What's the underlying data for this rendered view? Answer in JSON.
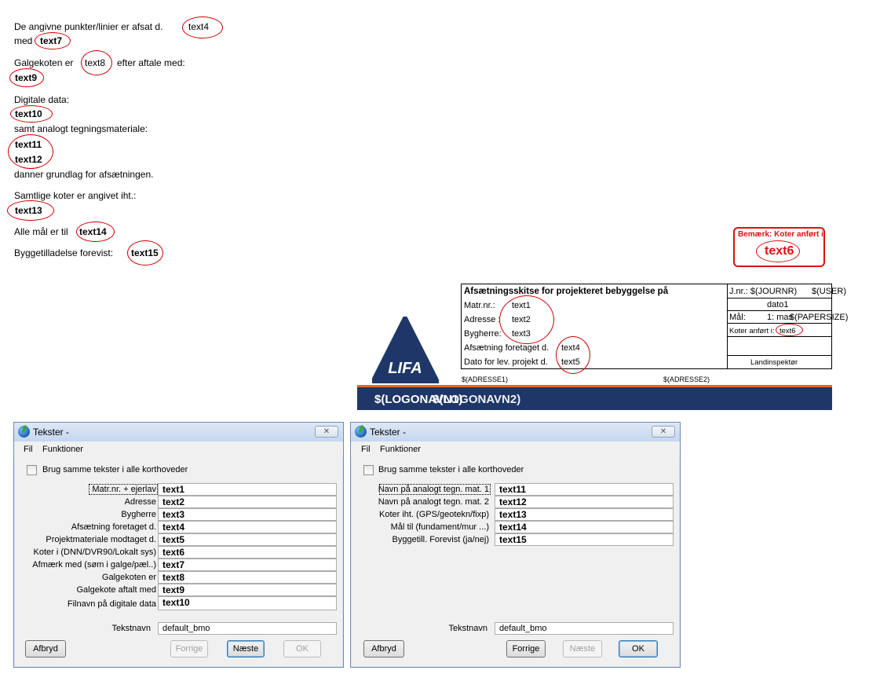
{
  "drawing": {
    "notes": {
      "line1": "De angivne punkter/linier er afsat d.",
      "line1_val": "text4",
      "med": "med",
      "med_val": "text7",
      "galge": "Galgekoten er",
      "galge_val": "text8",
      "galge_rest": "efter aftale med:",
      "text9": "text9",
      "digitale": "Digitale data:",
      "text10": "text10",
      "analogt": "samt analogt tegningsmateriale:",
      "text11": "text11",
      "text12": "text12",
      "danner": "danner grundlag for afsætningen.",
      "koter": "Samtlige koter er angivet iht.:",
      "text13": "text13",
      "maal": "Alle mål er til",
      "maal_val": "text14",
      "bygge": "Byggetilladelse forevist:",
      "bygge_val": "text15"
    },
    "remark": {
      "label": "Bemærk: Koter anført i",
      "value": "text6"
    },
    "title_block": {
      "heading": "Afsætningsskitse for projekteret bebyggelse på",
      "matr_label": "Matr.nr.:",
      "matr_val": "text1",
      "adresse_label": "Adresse :",
      "adresse_val": "text2",
      "bygherre_label": "Bygherre:",
      "bygherre_val": "text3",
      "afsat_label": "Afsætning foretaget d.",
      "afsat_val": "text4",
      "dato_label": "Dato for lev. projekt d.",
      "dato_val": "text5",
      "jnr": "J.nr.: $(JOURNR)",
      "user": "$(USER)",
      "dato1": "dato1",
      "maal_label": "Mål:",
      "maal_scale": "1: mas",
      "papersize": "$(PAPERSIZE)",
      "koter_label": "Koter anført i:",
      "koter_val": "text6",
      "landinspektor": "Landinspektør",
      "adresse1": "$(ADRESSE1)",
      "adresse2": "$(ADRESSE2)"
    },
    "logo": {
      "text": "LIFA",
      "bar_left": "$(LOGONAVN1)",
      "bar_right": "$(LOGONAVN2)"
    }
  },
  "dialog_left": {
    "title": "Tekster -",
    "close": "✕",
    "menu": [
      "Fil",
      "Funktioner"
    ],
    "checkbox_label": "Brug samme tekster i alle korthoveder",
    "rows": [
      {
        "label": "Matr.nr. + ejerlav",
        "value": "text1"
      },
      {
        "label": "Adresse",
        "value": "text2"
      },
      {
        "label": "Bygherre",
        "value": "text3"
      },
      {
        "label": "Afsætning foretaget d.",
        "value": "text4"
      },
      {
        "label": "Projektmateriale modtaget d.",
        "value": "text5"
      },
      {
        "label": "Koter i (DNN/DVR90/Lokalt sys)",
        "value": "text6"
      },
      {
        "label": "Afmærk med (søm i galge/pæl..)",
        "value": "text7"
      },
      {
        "label": "Galgekoten er",
        "value": "text8"
      },
      {
        "label": "Galgekote aftalt med",
        "value": "text9"
      },
      {
        "label": "Filnavn på digitale data",
        "value": "text10"
      }
    ],
    "tekstnavn_label": "Tekstnavn",
    "tekstnavn_value": "default_bmo",
    "buttons": {
      "cancel": "Afbryd",
      "prev": "Forrige",
      "next": "Næste",
      "ok": "OK"
    }
  },
  "dialog_right": {
    "title": "Tekster -",
    "close": "✕",
    "menu": [
      "Fil",
      "Funktioner"
    ],
    "checkbox_label": "Brug samme tekster i alle korthoveder",
    "rows": [
      {
        "label": "Navn på analogt tegn. mat. 1",
        "value": "text11"
      },
      {
        "label": "Navn på analogt tegn. mat. 2",
        "value": "text12"
      },
      {
        "label": "Koter iht. (GPS/geotekn/fixp)",
        "value": "text13"
      },
      {
        "label": "Mål til (fundament/mur ...)",
        "value": "text14"
      },
      {
        "label": "Byggetill. Forevist (ja/nej)",
        "value": "text15"
      }
    ],
    "tekstnavn_label": "Tekstnavn",
    "tekstnavn_value": "default_bmo",
    "buttons": {
      "cancel": "Afbryd",
      "prev": "Forrige",
      "next": "Næste",
      "ok": "OK"
    }
  },
  "colors": {
    "oval": "#cc0000",
    "remark": "#e01010",
    "logo_blue": "#1f3768",
    "logo_orange": "#e86a1a"
  }
}
